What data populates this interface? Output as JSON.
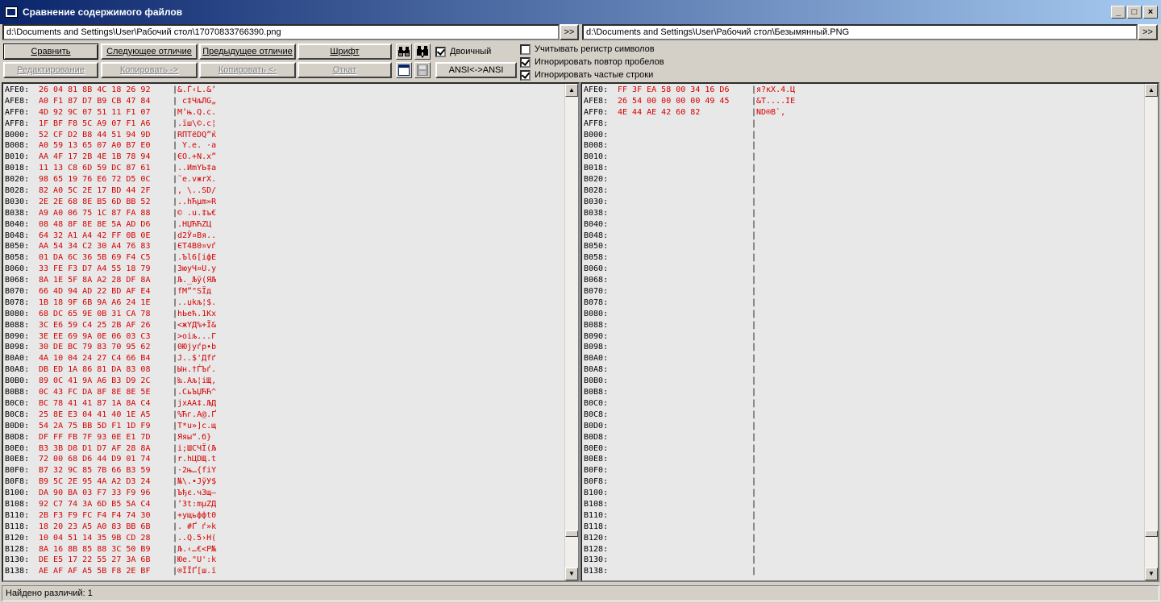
{
  "window": {
    "title": "Сравнение содержимого файлов",
    "minimize": "_",
    "maximize": "□",
    "close": "×"
  },
  "paths": {
    "left": "d:\\Documents and Settings\\User\\Рабочий стол\\17070833766390.png",
    "right": "d:\\Documents and Settings\\User\\Рабочий стол\\Безымянный.PNG",
    "browse_label": ">>"
  },
  "toolbar": {
    "compare": "Сравнить",
    "next_diff": "Следующее отличие",
    "prev_diff": "Предыдущее отличие",
    "font": "Шрифт",
    "edit": "Редактирование",
    "copy_right": "Копировать ->",
    "copy_left": "Копировать <-",
    "undo": "Откат",
    "binary": "Двоичный",
    "ansi": "ANSI<->ANSI"
  },
  "options": {
    "case_sensitive": {
      "label": "Учитывать регистр символов",
      "checked": false
    },
    "ignore_spaces": {
      "label": "Игнорировать повтор пробелов",
      "checked": true
    },
    "ignore_frequent": {
      "label": "Игнорировать частые строки",
      "checked": true
    }
  },
  "left_pane": {
    "rows": [
      [
        "AFE0:",
        "26 04 81 8B 4C 18 26 92",
        "&.Ѓ‹L.&’"
      ],
      [
        "AFE8:",
        "A0 F1 87 D7 B9 CB 47 84",
        " с‡ЧљЛG„"
      ],
      [
        "AFF0:",
        "4D 92 9C 07 51 11 F1 07",
        "M’њ.Q.с."
      ],
      [
        "AFF8:",
        "1F BF F8 5C A9 07 F1 A6",
        ".їш\\©.с¦"
      ],
      [
        "B000:",
        "52 CF D2 B8 44 51 94 9D",
        "RПТёDQ”ќ"
      ],
      [
        "B008:",
        "A0 59 13 65 07 A0 B7 E0",
        " Y.e. ·а"
      ],
      [
        "B010:",
        "AA 4F 17 2B 4E 1B 78 94",
        "ЄO.+N.x”"
      ],
      [
        "B018:",
        "11 13 C8 6D 59 DC 87 61",
        "..ИmYЬ‡a"
      ],
      [
        "B020:",
        "98 65 19 76 E6 72 D5 0C",
        "˜e.vжrХ."
      ],
      [
        "B028:",
        "82 A0 5C 2E 17 BD 44 2F",
        "‚ \\..ЅD/"
      ],
      [
        "B030:",
        "2E 2E 68 8E B5 6D BB 52",
        "..hЋµm»R"
      ],
      [
        "B038:",
        "A9 A0 06 75 1C 87 FA 88",
        "© .u.‡ъ€"
      ],
      [
        "B040:",
        "08 48 8F 8E 8E 5A AD D6",
        ".HЏЋЋZ­Ц"
      ],
      [
        "B048:",
        "64 32 A1 A4 42 FF 0B 0E",
        "d2Ў¤Bя.."
      ],
      [
        "B050:",
        "AA 54 34 C2 30 A4 76 83",
        "ЄT4В0¤vѓ"
      ],
      [
        "B058:",
        "01 DA 6C 36 5B 69 F4 C5",
        ".Ъl6[iфЕ"
      ],
      [
        "B060:",
        "33 FE F3 D7 A4 55 18 79",
        "3юуЧ¤U.y"
      ],
      [
        "B068:",
        "8A 1E 5F 8A A2 28 DF 8A",
        "Љ._Љў(ЯЉ"
      ],
      [
        "B070:",
        "66 4D 94 AD 22 BD AF E4",
        "fM”­\"ЅЇд"
      ],
      [
        "B078:",
        "1B 18 9F 6B 9A A6 24 1E",
        "..џkљ¦$."
      ],
      [
        "B080:",
        "68 DC 65 9E 0B 31 CA 78",
        "hЬeћ.1Кx"
      ],
      [
        "B088:",
        "3C E6 59 C4 25 2B AF 26",
        "<жYД%+Ї&"
      ],
      [
        "B090:",
        "3E EE 69 9A 0E 06 03 C3",
        ">оiљ...Г"
      ],
      [
        "B098:",
        "30 DE BC 79 83 70 95 62",
        "0Юјyѓp•b"
      ],
      [
        "B0A0:",
        "4A 10 04 24 27 C4 66 B4",
        "J..$'Дfґ"
      ],
      [
        "B0A8:",
        "DB ED 1A 86 81 DA 83 08",
        "Ын.†ЃЪѓ."
      ],
      [
        "B0B0:",
        "89 0C 41 9A A6 B3 D9 2C",
        "‰.Aљ¦іЩ,"
      ],
      [
        "B0B8:",
        "0C 43 FC DA 8F 8E 8E 5E",
        ".CьЪЏЋЋ^"
      ],
      [
        "B0C0:",
        "BC 78 41 41 87 1A 8A C4",
        "јxAA‡.ЉД"
      ],
      [
        "B0C8:",
        "25 8E E3 04 41 40 1E A5",
        "%Ћг.A@.Ґ"
      ],
      [
        "B0D0:",
        "54 2A 75 BB 5D F1 1D F9",
        "T*u»]с.щ"
      ],
      [
        "B0D8:",
        "DF FF FB 7F 93 0E E1 7D",
        "Яяы“.б}"
      ],
      [
        "B0E0:",
        "B3 3B D8 D1 D7 AF 28 8A",
        "і;ШСЧЇ(Љ"
      ],
      [
        "B0E8:",
        "72 00 68 D6 44 D9 01 74",
        "r.hЦDЩ.t"
      ],
      [
        "B0F0:",
        "B7 32 9C 85 7B 66 B3 59",
        "·2њ…{fіY"
      ],
      [
        "B0F8:",
        "B9 5C 2E 95 4A A2 D3 24",
        "№\\.•JўУ$"
      ],
      [
        "B100:",
        "DA 90 BA 03 F7 33 F9 96",
        "Ъђє.ч3щ–"
      ],
      [
        "B108:",
        "92 C7 74 3A 6D B5 5A C4",
        "’Зt:mµZД"
      ],
      [
        "B110:",
        "2B F3 F9 FC F4 F4 74 30",
        "+ущьффt0"
      ],
      [
        "B118:",
        "18 20 23 A5 A0 83 BB 6B",
        ". #Ґ ѓ»k"
      ],
      [
        "B120:",
        "10 04 51 14 35 9B CD 28",
        "..Q.5›Н("
      ],
      [
        "B128:",
        "8A 16 8B 85 88 3C 50 B9",
        "Љ.‹…€<P№"
      ],
      [
        "B130:",
        "DE E5 17 22 55 27 3A 6B",
        "Юе.\"U':k"
      ],
      [
        "B138:",
        "AE AF AF A5 5B F8 2E BF",
        "®ЇЇҐ[ш.ї"
      ]
    ]
  },
  "right_pane": {
    "rows": [
      [
        "AFE0:",
        "FF 3F EA 58 00 34 16 D6",
        "я?кX.4.Ц"
      ],
      [
        "AFE8:",
        "26 54 00 00 00 00 49 45",
        "&T....IE"
      ],
      [
        "AFF0:",
        "4E 44 AE 42 60 82",
        "ND®B`‚"
      ],
      [
        "AFF8:",
        "",
        ""
      ],
      [
        "B000:",
        "",
        ""
      ],
      [
        "B008:",
        "",
        ""
      ],
      [
        "B010:",
        "",
        ""
      ],
      [
        "B018:",
        "",
        ""
      ],
      [
        "B020:",
        "",
        ""
      ],
      [
        "B028:",
        "",
        ""
      ],
      [
        "B030:",
        "",
        ""
      ],
      [
        "B038:",
        "",
        ""
      ],
      [
        "B040:",
        "",
        ""
      ],
      [
        "B048:",
        "",
        ""
      ],
      [
        "B050:",
        "",
        ""
      ],
      [
        "B058:",
        "",
        ""
      ],
      [
        "B060:",
        "",
        ""
      ],
      [
        "B068:",
        "",
        ""
      ],
      [
        "B070:",
        "",
        ""
      ],
      [
        "B078:",
        "",
        ""
      ],
      [
        "B080:",
        "",
        ""
      ],
      [
        "B088:",
        "",
        ""
      ],
      [
        "B090:",
        "",
        ""
      ],
      [
        "B098:",
        "",
        ""
      ],
      [
        "B0A0:",
        "",
        ""
      ],
      [
        "B0A8:",
        "",
        ""
      ],
      [
        "B0B0:",
        "",
        ""
      ],
      [
        "B0B8:",
        "",
        ""
      ],
      [
        "B0C0:",
        "",
        ""
      ],
      [
        "B0C8:",
        "",
        ""
      ],
      [
        "B0D0:",
        "",
        ""
      ],
      [
        "B0D8:",
        "",
        ""
      ],
      [
        "B0E0:",
        "",
        ""
      ],
      [
        "B0E8:",
        "",
        ""
      ],
      [
        "B0F0:",
        "",
        ""
      ],
      [
        "B0F8:",
        "",
        ""
      ],
      [
        "B100:",
        "",
        ""
      ],
      [
        "B108:",
        "",
        ""
      ],
      [
        "B110:",
        "",
        ""
      ],
      [
        "B118:",
        "",
        ""
      ],
      [
        "B120:",
        "",
        ""
      ],
      [
        "B128:",
        "",
        ""
      ],
      [
        "B130:",
        "",
        ""
      ],
      [
        "B138:",
        "",
        ""
      ]
    ]
  },
  "scrollbar": {
    "up": "▲",
    "down": "▼"
  },
  "status": {
    "text": "Найдено различий: 1"
  },
  "colors": {
    "title_start": "#0a246a",
    "title_end": "#a6caf0",
    "diff_text": "#d40000",
    "window_bg": "#d4d0c8"
  }
}
